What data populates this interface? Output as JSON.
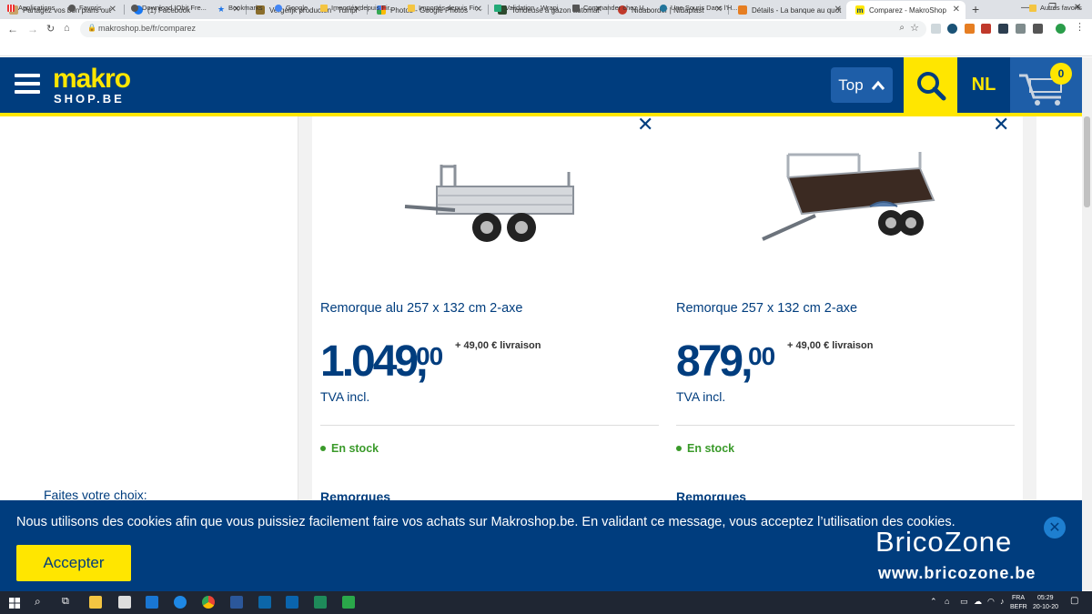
{
  "browser": {
    "tabs": [
      {
        "title": "Partagez vos bon plans out",
        "color": "#c9a36a"
      },
      {
        "title": "(1) Facebook",
        "color": "#1877f2"
      },
      {
        "title": "Vergelijk producten - Tuinpl",
        "color": "#8a6d2b"
      },
      {
        "title": "Photos - Google Photos",
        "color": "#fbbc04"
      },
      {
        "title": "Tondeuse à gazon automat",
        "color": "#2e4a2e"
      },
      {
        "title": "Nidaborder | Nidaplast",
        "color": "#c0392b"
      },
      {
        "title": "Détails - La banque au quot",
        "color": "#e67e22"
      },
      {
        "title": "Comparez - MakroShop",
        "color": "#003d7e"
      }
    ],
    "new_tab": "+",
    "url": "makroshop.be/fr/comparez",
    "bookmarks": [
      {
        "label": "Applications",
        "color": "#e33"
      },
      {
        "label": "Favoris",
        "color": "#555"
      },
      {
        "label": "Download IObit Fre...",
        "color": "#555"
      },
      {
        "label": "Bookmarks",
        "color": "#1a73e8"
      },
      {
        "label": "Google",
        "color": "#4285f4"
      },
      {
        "label": "Importés depuis Fir...",
        "color": "#f4c542"
      },
      {
        "label": "Importés depuis Fir...",
        "color": "#f4c542"
      },
      {
        "label": "Validation - Wrapi",
        "color": "#2a7"
      },
      {
        "label": "Commander chez U...",
        "color": "#555"
      },
      {
        "label": "Une Souris Dans l'H...",
        "color": "#21759b"
      }
    ],
    "other_bookmarks": "Autres favoris"
  },
  "header": {
    "logo_top": "makro",
    "logo_bottom": "SHOP.BE",
    "top_label": "Top",
    "lang": "NL",
    "cart_count": "0"
  },
  "page": {
    "choice_label": "Faites votre choix:",
    "products": [
      {
        "name": "Remorque alu 257 x 132 cm 2-axe",
        "price_int": "1.049,",
        "price_cents": "00",
        "delivery": "+ 49,00 € livraison",
        "tva": "TVA incl.",
        "stock": "En stock",
        "category": "Remorques"
      },
      {
        "name": "Remorque 257 x 132 cm 2-axe",
        "price_int": "879,",
        "price_cents": "00",
        "delivery": "+ 49,00 € livraison",
        "tva": "TVA incl.",
        "stock": "En stock",
        "category": "Remorques"
      }
    ]
  },
  "cookie": {
    "text": "Nous utilisons des cookies afin que vous puissiez facilement faire vos achats sur Makroshop.be. En validant ce message, vous acceptez l’utilisation des cookies.",
    "accept": "Accepter"
  },
  "watermark": {
    "line1": "BricoZone",
    "line2": "www.bricozone.be"
  },
  "taskbar": {
    "lang_top": "FRA",
    "lang_bottom": "BEFR",
    "time": "05:29",
    "date": "20-10-20"
  },
  "colors": {
    "brand_blue": "#003d7e",
    "brand_yellow": "#ffe600",
    "stock_green": "#3a9a2a"
  }
}
